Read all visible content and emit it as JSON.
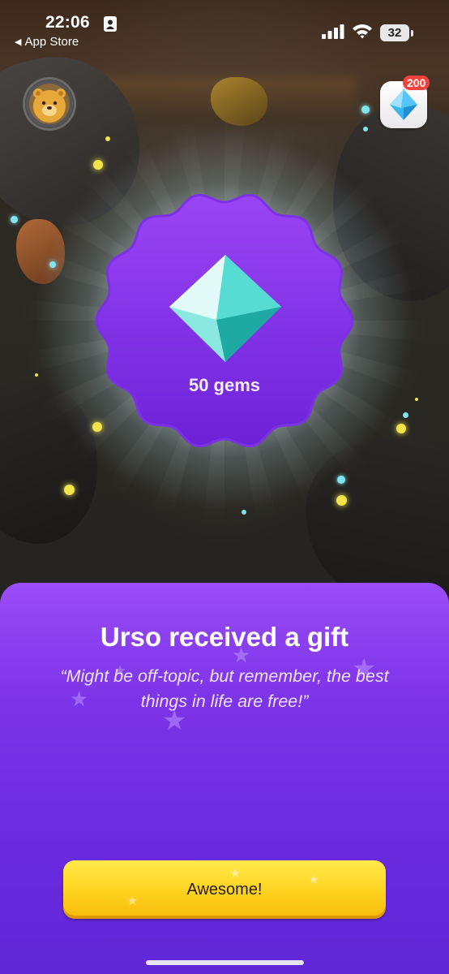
{
  "status_bar": {
    "time": "22:06",
    "back_label": "App Store",
    "battery_level": "32"
  },
  "hud": {
    "gem_count": "200"
  },
  "reward": {
    "label": "50 gems"
  },
  "sheet": {
    "title": "Urso received a gift",
    "quote": "“Might be off-topic, but remember, the best things in life are free!”",
    "button_label": "Awesome!"
  },
  "colors": {
    "sheet_purple": "#7c34e8",
    "badge_purple": "#8a3cf0",
    "button_yellow": "#ffd21f",
    "gem_teal": "#3fd6cf"
  }
}
